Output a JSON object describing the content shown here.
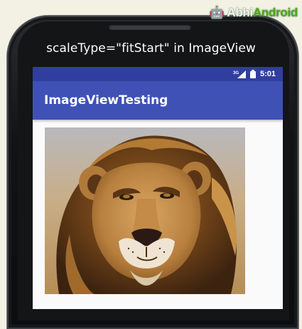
{
  "watermark": {
    "prefix": "Abhi",
    "accent": "Android"
  },
  "caption": "scaleType=\"fitStart\" in ImageView",
  "status_bar": {
    "network": "3G",
    "time": "5:01"
  },
  "app_bar": {
    "title": "ImageViewTesting"
  },
  "colors": {
    "status_bar": "#303f9f",
    "app_bar": "#3f51b5",
    "screen_background": "#fafafa",
    "watermark_accent": "#4ba81f"
  },
  "image": {
    "subject": "lion",
    "scale_type": "fitStart"
  }
}
